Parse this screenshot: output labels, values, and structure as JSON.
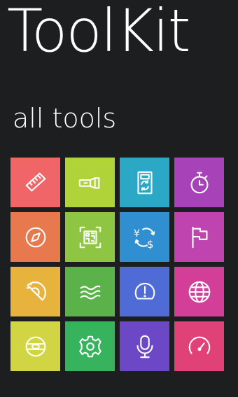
{
  "header": {
    "app_title": "ToolKit",
    "section_title": "all tools"
  },
  "tiles": [
    {
      "icon": "ruler-icon",
      "color": "#f06668"
    },
    {
      "icon": "flashlight-icon",
      "color": "#b0d33a"
    },
    {
      "icon": "calculator-icon",
      "color": "#2aa8c6"
    },
    {
      "icon": "stopwatch-icon",
      "color": "#a742b8"
    },
    {
      "icon": "compass-icon",
      "color": "#e8794f"
    },
    {
      "icon": "qr-scanner-icon",
      "color": "#8ec543"
    },
    {
      "icon": "currency-converter-icon",
      "color": "#2f8fd0"
    },
    {
      "icon": "flag-icon",
      "color": "#c044b0"
    },
    {
      "icon": "protractor-icon",
      "color": "#e8b33d"
    },
    {
      "icon": "wind-icon",
      "color": "#5cb24a"
    },
    {
      "icon": "alert-gauge-icon",
      "color": "#4f6bd6"
    },
    {
      "icon": "globe-icon",
      "color": "#d23e98"
    },
    {
      "icon": "level-icon",
      "color": "#d2d543"
    },
    {
      "icon": "settings-gear-icon",
      "color": "#36b35c"
    },
    {
      "icon": "microphone-icon",
      "color": "#6c47c6"
    },
    {
      "icon": "speedometer-icon",
      "color": "#e04277"
    }
  ]
}
